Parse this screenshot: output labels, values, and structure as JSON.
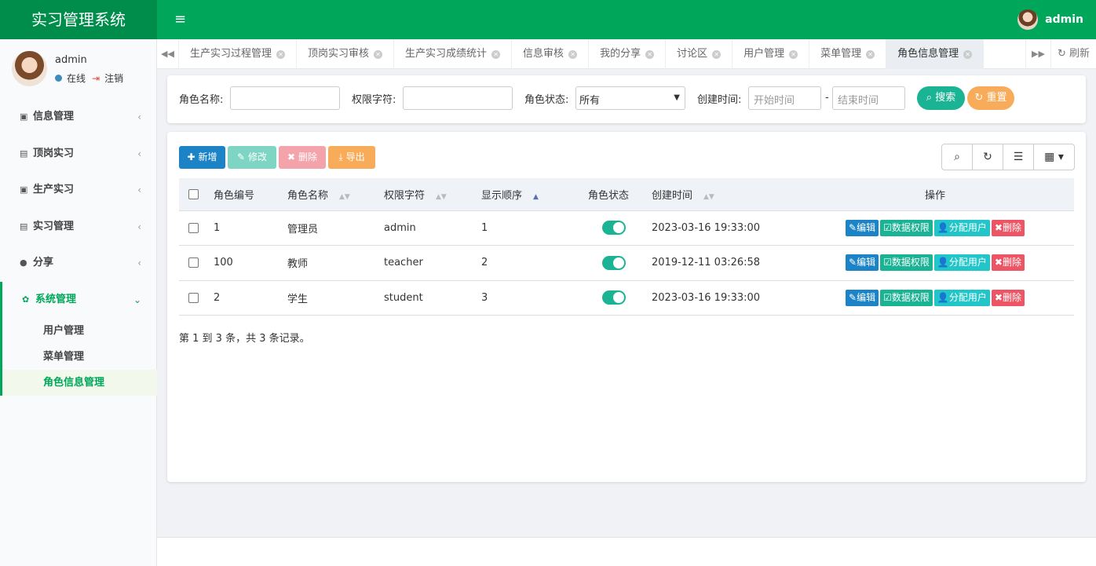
{
  "header": {
    "app_title": "实习管理系统",
    "menu_toggle": "≡",
    "user_name": "admin"
  },
  "sidebar": {
    "user_name": "admin",
    "status_online": "在线",
    "logout": "注销",
    "menu": [
      {
        "label": "信息管理",
        "icon": "id-card-icon"
      },
      {
        "label": "顶岗实习",
        "icon": "address-card-icon"
      },
      {
        "label": "生产实习",
        "icon": "user-card-icon"
      },
      {
        "label": "实习管理",
        "icon": "vcard-icon"
      },
      {
        "label": "分享",
        "icon": "comment-icon"
      },
      {
        "label": "系统管理",
        "icon": "gear-icon"
      }
    ],
    "submenu": [
      {
        "label": "用户管理"
      },
      {
        "label": "菜单管理"
      },
      {
        "label": "角色信息管理"
      }
    ]
  },
  "tabs": [
    {
      "label": "生产实习过程管理"
    },
    {
      "label": "顶岗实习审核"
    },
    {
      "label": "生产实习成绩统计"
    },
    {
      "label": "信息审核"
    },
    {
      "label": "我的分享"
    },
    {
      "label": "讨论区"
    },
    {
      "label": "用户管理"
    },
    {
      "label": "菜单管理"
    },
    {
      "label": "角色信息管理"
    }
  ],
  "tabs_refresh": "刷新",
  "search": {
    "role_name_label": "角色名称:",
    "perm_label": "权限字符:",
    "status_label": "角色状态:",
    "status_value": "所有",
    "created_label": "创建时间:",
    "start_placeholder": "开始时间",
    "end_placeholder": "结束时间",
    "range_sep": "-",
    "search_btn": "搜索",
    "reset_btn": "重置"
  },
  "toolbar": {
    "add": "新增",
    "edit": "修改",
    "delete": "删除",
    "export": "导出"
  },
  "table": {
    "columns": [
      "角色编号",
      "角色名称",
      "权限字符",
      "显示顺序",
      "角色状态",
      "创建时间",
      "操作"
    ],
    "rows": [
      {
        "id": "1",
        "name": "管理员",
        "key": "admin",
        "order": "1",
        "enabled": true,
        "created": "2023-03-16 19:33:00"
      },
      {
        "id": "100",
        "name": "教师",
        "key": "teacher",
        "order": "2",
        "enabled": true,
        "created": "2019-12-11 03:26:58"
      },
      {
        "id": "2",
        "name": "学生",
        "key": "student",
        "order": "3",
        "enabled": true,
        "created": "2023-03-16 19:33:00"
      }
    ],
    "actions": {
      "edit": "编辑",
      "data_perm": "数据权限",
      "assign": "分配用户",
      "delete": "删除"
    }
  },
  "pagination_text": "第 1 到 3 条，共 3 条记录。",
  "colors": {
    "brand": "#00a65a",
    "brand_dark": "#008d4c",
    "primary": "#1c84c6",
    "success": "#1ab394",
    "info": "#23c6c8",
    "danger": "#ed5565",
    "warning": "#f8ac59"
  }
}
